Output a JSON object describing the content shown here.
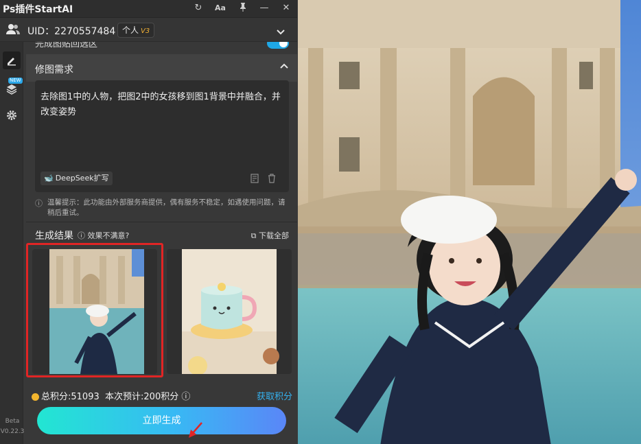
{
  "app": {
    "title": "Ps插件StartAI"
  },
  "titlebar": {
    "refresh_icon": "↻",
    "font_icon": "Aa",
    "pin_icon": "📌",
    "minimize_icon": "—",
    "close_icon": "✕"
  },
  "user": {
    "uid": "UID：2270557484",
    "account_type": "个人",
    "level": "V3"
  },
  "sidebar": {
    "new_badge": "NEW",
    "beta": "Beta",
    "version": "V0.22.3"
  },
  "partial_setting": {
    "label": "完成图贴回选区",
    "enabled": true
  },
  "section": {
    "label": "修图需求"
  },
  "prompt": {
    "text": "去除图1中的人物，把图2中的女孩移到图1背景中并融合，并改变姿势",
    "deepseek_label": "DeepSeek扩写"
  },
  "tip": {
    "text": "温馨提示：此功能由外部服务商提供，偶有服务不稳定，如遇使用问题，请稍后重试。"
  },
  "results": {
    "title": "生成结果",
    "feedback": "效果不满意?",
    "download_all": "下载全部"
  },
  "points": {
    "total": "总积分:51093",
    "estimate": "本次预计:200积分",
    "get_points": "获取积分"
  },
  "generate": {
    "label": "立即生成"
  },
  "colors": {
    "accent": "#34b2f0",
    "highlight": "#e12525",
    "coin": "#f3b62e"
  }
}
